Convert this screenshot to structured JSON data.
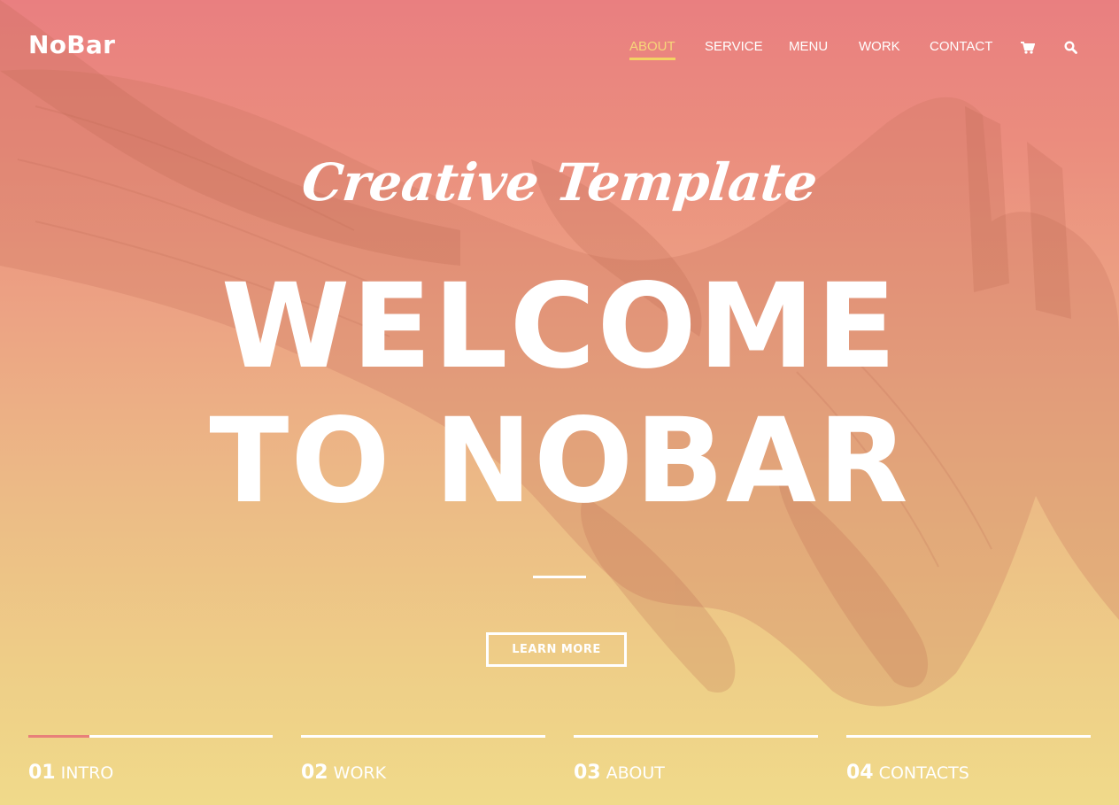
{
  "brand": {
    "logo": "NoBar"
  },
  "nav": {
    "items": [
      {
        "label": "ABOUT",
        "active": true
      },
      {
        "label": "SERVICE",
        "active": false
      },
      {
        "label": "MENU",
        "active": false
      },
      {
        "label": "WORK",
        "active": false
      },
      {
        "label": "CONTACT",
        "active": false
      }
    ],
    "icons": [
      "cart-icon",
      "search-icon"
    ],
    "active_color": "#f3d264"
  },
  "hero": {
    "script_title": "Creative Template",
    "title_line1": "WELCOME",
    "title_line2": "TO NOBAR",
    "button_label": "LEARN MORE",
    "gradient_top": "#e97f80",
    "gradient_bottom": "#f0da8a"
  },
  "slides": [
    {
      "num": "01",
      "label": "INTRO",
      "progress": 0.25
    },
    {
      "num": "02",
      "label": "WORK",
      "progress": 0
    },
    {
      "num": "03",
      "label": "ABOUT",
      "progress": 0
    },
    {
      "num": "04",
      "label": "CONTACTS",
      "progress": 0
    }
  ],
  "progress_color": "#e8807a"
}
